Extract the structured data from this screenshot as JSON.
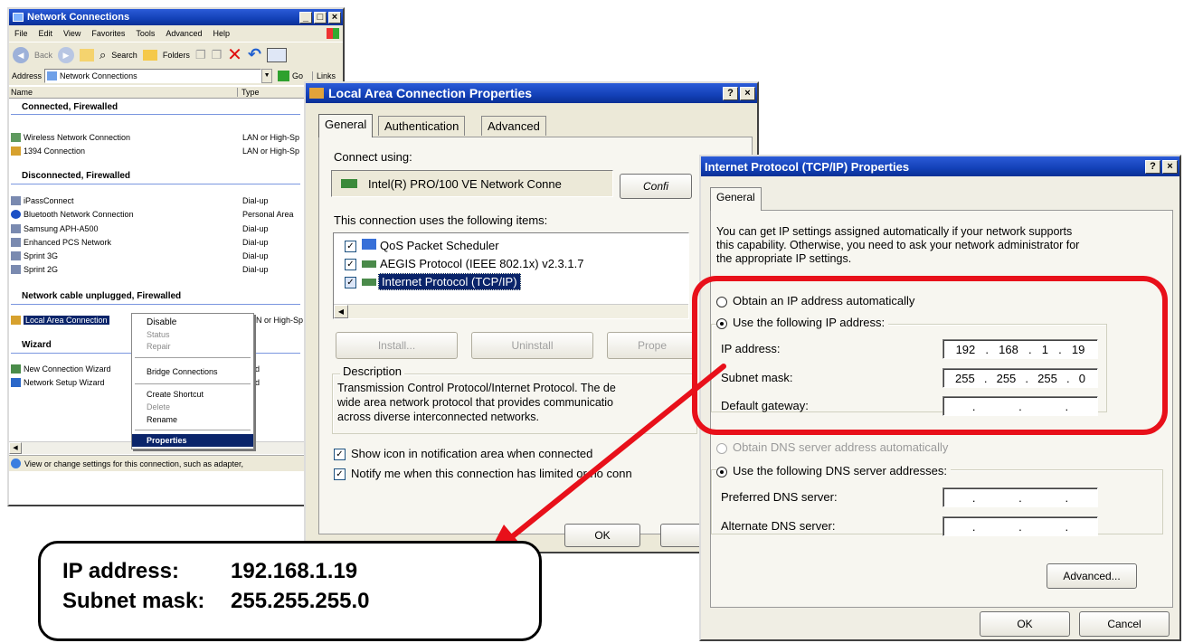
{
  "nc": {
    "title": "Network Connections",
    "menu": [
      "File",
      "Edit",
      "View",
      "Favorites",
      "Tools",
      "Advanced",
      "Help"
    ],
    "toolbar": {
      "back": "Back",
      "search": "Search",
      "folders": "Folders"
    },
    "address_label": "Address",
    "address_value": "Network Connections",
    "go": "Go",
    "links": "Links",
    "col_name": "Name",
    "col_type": "Type",
    "groups": [
      {
        "heading": "Connected, Firewalled",
        "items": [
          {
            "name": "Wireless Network Connection",
            "type": "LAN or High-Sp"
          },
          {
            "name": "1394 Connection",
            "type": "LAN or High-Sp"
          }
        ]
      },
      {
        "heading": "Disconnected, Firewalled",
        "items": [
          {
            "name": "iPassConnect",
            "type": "Dial-up"
          },
          {
            "name": "Bluetooth Network Connection",
            "type": "Personal Area"
          },
          {
            "name": "Samsung APH-A500",
            "type": "Dial-up"
          },
          {
            "name": "Enhanced PCS Network",
            "type": "Dial-up"
          },
          {
            "name": "Sprint 3G",
            "type": "Dial-up"
          },
          {
            "name": "Sprint 2G",
            "type": "Dial-up"
          }
        ]
      },
      {
        "heading": "Network cable unplugged, Firewalled",
        "items": [
          {
            "name": "Local Area Connection",
            "type": "LAN or High-Sp"
          }
        ]
      },
      {
        "heading": "Wizard",
        "items": [
          {
            "name": "New Connection Wizard",
            "type": "ard"
          },
          {
            "name": "Network Setup Wizard",
            "type": "ard"
          }
        ]
      }
    ],
    "status": "View or change settings for this connection, such as adapter,"
  },
  "ctx": {
    "items": [
      {
        "label": "Disable",
        "disabled": false
      },
      {
        "label": "Status",
        "disabled": true
      },
      {
        "label": "Repair",
        "disabled": true
      },
      {
        "label": "Bridge Connections",
        "disabled": false
      },
      {
        "label": "Create Shortcut",
        "disabled": false
      },
      {
        "label": "Delete",
        "disabled": true
      },
      {
        "label": "Rename",
        "disabled": false
      },
      {
        "label": "Properties",
        "disabled": false
      }
    ]
  },
  "lac": {
    "title": "Local Area Connection Properties",
    "tabs": [
      "General",
      "Authentication",
      "Advanced"
    ],
    "connect_using": "Connect using:",
    "adapter": "Intel(R) PRO/100 VE Network Conne",
    "configure": "Confi",
    "items_label": "This connection uses the following items:",
    "items": [
      "QoS Packet Scheduler",
      "AEGIS Protocol (IEEE 802.1x) v2.3.1.7",
      "Internet Protocol (TCP/IP)"
    ],
    "install": "Install...",
    "uninstall": "Uninstall",
    "properties": "Prope",
    "description_label": "Description",
    "description_lines": [
      "Transmission Control Protocol/Internet Protocol. The de",
      "wide area network protocol that provides communicatio",
      "across diverse interconnected networks."
    ],
    "show_icon": "Show icon in notification area when connected",
    "notify": "Notify me when this connection has limited or no conn",
    "ok": "OK"
  },
  "tcp": {
    "title": "Internet Protocol (TCP/IP) Properties",
    "tab": "General",
    "intro_lines": [
      "You can get IP settings assigned automatically if your network supports",
      "this capability. Otherwise, you need to ask your network administrator for",
      "the appropriate IP settings."
    ],
    "auto_ip": "Obtain an IP address automatically",
    "use_ip": "Use the following IP address:",
    "ip_label": "IP address:",
    "ip": [
      "192",
      "168",
      "1",
      "19"
    ],
    "mask_label": "Subnet mask:",
    "mask": [
      "255",
      "255",
      "255",
      "0"
    ],
    "gw_label": "Default gateway:",
    "auto_dns": "Obtain DNS server address automatically",
    "use_dns": "Use the following DNS server addresses:",
    "pref_dns": "Preferred DNS server:",
    "alt_dns": "Alternate DNS server:",
    "advanced": "Advanced...",
    "ok": "OK",
    "cancel": "Cancel"
  },
  "callout": {
    "ip_label": "IP address:",
    "ip_value": "192.168.1.19",
    "mask_label": "Subnet mask:",
    "mask_value": "255.255.255.0"
  },
  "colors": {
    "highlight": "#0a246a",
    "callout_red": "#e8101a",
    "title_blue": "#1341b7"
  }
}
